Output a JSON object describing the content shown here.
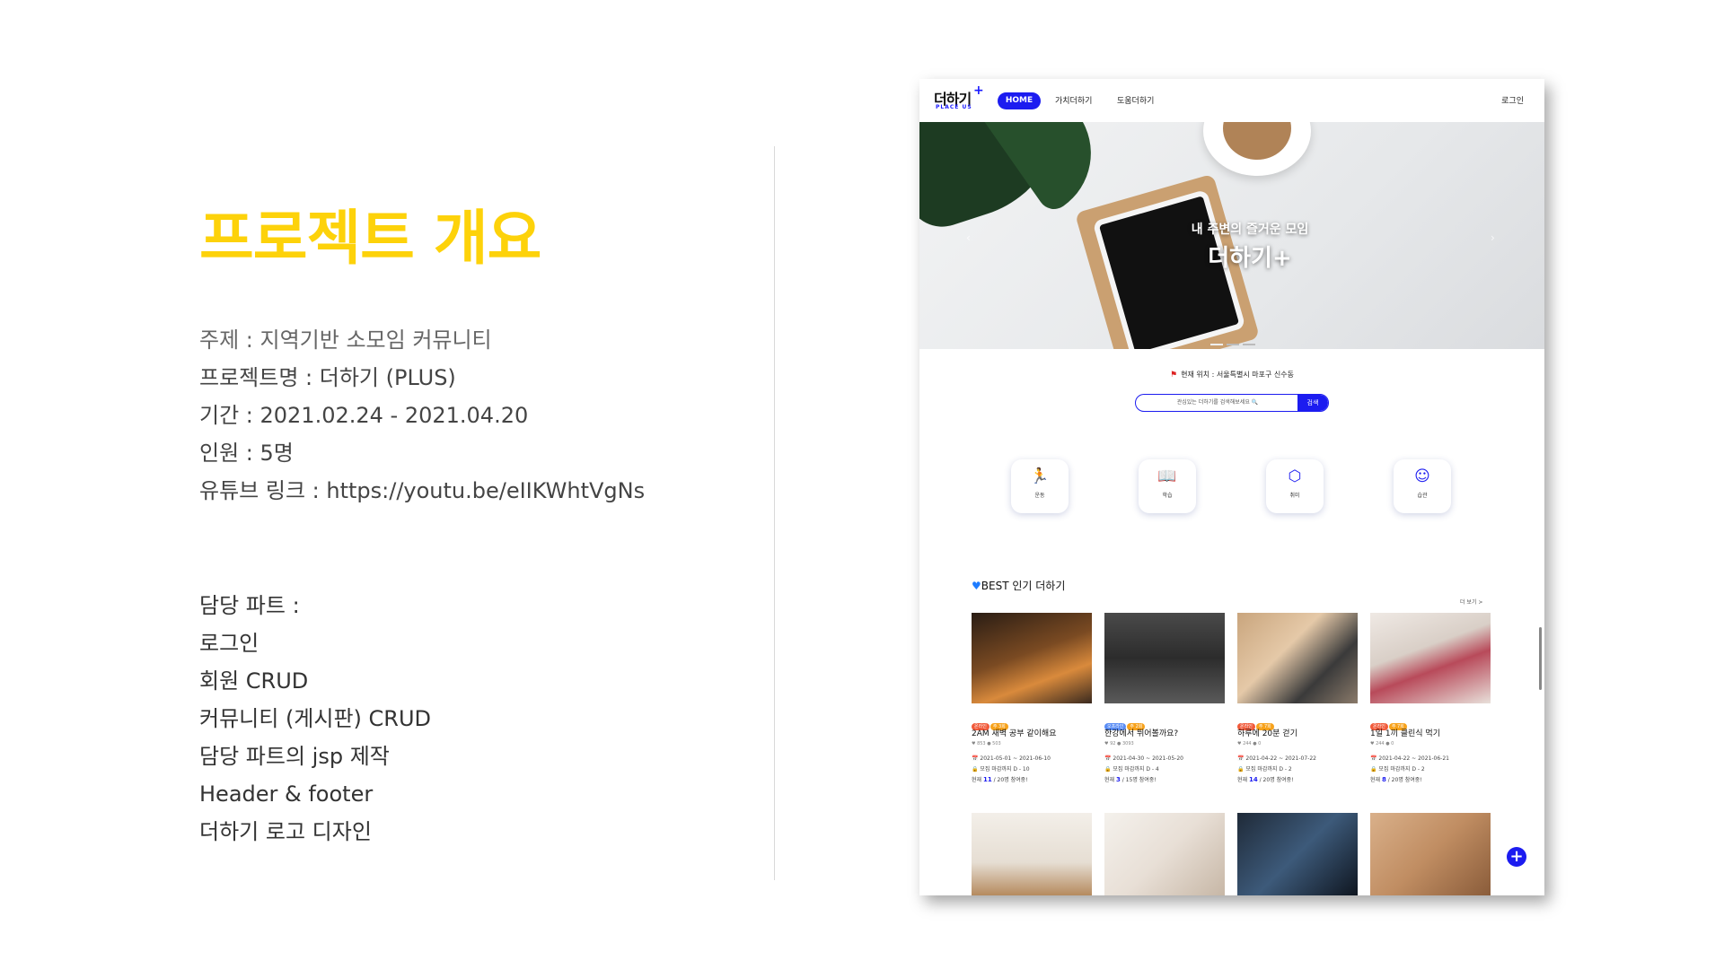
{
  "slide": {
    "title": "프로젝트 개요",
    "info": [
      "주제 : 지역기반 소모임 커뮤니티",
      "프로젝트명 : 더하기  (PLUS)",
      "기간 : 2021.02.24 - 2021.04.20",
      "인원 : 5명",
      "유튜브 링크 : https://youtu.be/eIIKWhtVgNs"
    ],
    "part_header": "담당 파트 :",
    "parts": [
      "로그인",
      "회원 CRUD",
      "커뮤니티 (게시판) CRUD",
      "담당 파트의 jsp 제작",
      "Header & footer",
      "더하기 로고 디자인"
    ]
  },
  "site": {
    "logo_main": "더하기",
    "logo_plus": "+",
    "logo_sub": "PLACE US",
    "nav": [
      "HOME",
      "가치더하기",
      "도움더하기"
    ],
    "login": "로그인",
    "hero_sub": "내 주변의 즐거운 모임",
    "hero_main": "더하기+",
    "location": "현재 위치 : 서울특별시 마포구 신수동",
    "search_placeholder": "관심있는 더하기를 검색해보세요 🔍",
    "search_button": "검색",
    "categories": [
      {
        "label": "운동",
        "icon": "running-icon"
      },
      {
        "label": "학습",
        "icon": "book-icon"
      },
      {
        "label": "취미",
        "icon": "cubes-icon"
      },
      {
        "label": "습관",
        "icon": "smile-icon"
      }
    ],
    "best_title": "BEST 인기 더하기",
    "more": "더 보기 >",
    "cards": [
      {
        "badges": [
          "온라인",
          "주 3회"
        ],
        "title": "2AM 새벽 공부 같이해요",
        "stats": "♥ 853  ● 503",
        "period": "📅 2021-05-01 ~ 2021-06-10",
        "deadline": "🔒 모집 마감까지 D - 10",
        "current": "11",
        "total": "/ 20명 참여중!"
      },
      {
        "badges": [
          "오프라인",
          "주 2회"
        ],
        "title": "한강에서 뛰어볼까요?",
        "stats": "♥ 92  ● 3093",
        "period": "📅 2021-04-30 ~ 2021-05-20",
        "deadline": "🔒 모집 마감까지 D - 4",
        "current": "3",
        "total": "/ 15명 참여중!"
      },
      {
        "badges": [
          "온라인",
          "주 7회"
        ],
        "title": "하루에 20분 걷기",
        "stats": "♥ 244  ● 0",
        "period": "📅 2021-04-22 ~ 2021-07-22",
        "deadline": "🔒 모집 마감까지 D - 2",
        "current": "14",
        "total": "/ 20명 참여중!"
      },
      {
        "badges": [
          "온라인",
          "주 7회"
        ],
        "title": "1일 1끼 클린식 먹기",
        "stats": "♥ 244  ● 0",
        "period": "📅 2021-04-22 ~ 2021-06-21",
        "deadline": "🔒 모집 마감까지 D - 2",
        "current": "8",
        "total": "/ 20명 참여중!"
      }
    ],
    "fab": "+"
  }
}
